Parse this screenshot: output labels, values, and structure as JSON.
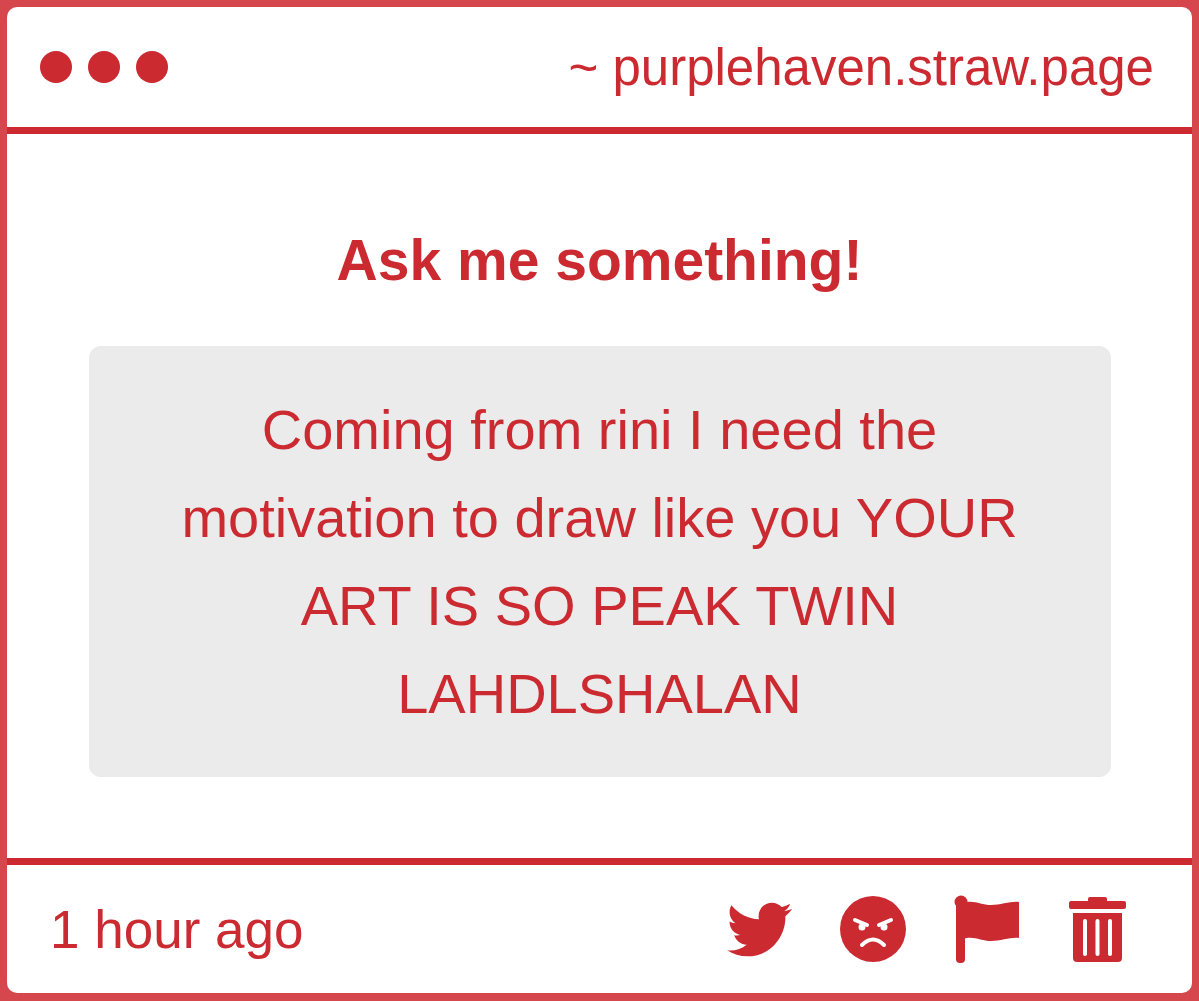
{
  "window": {
    "url": "~ purplehaven.straw.page"
  },
  "prompt": "Ask me something!",
  "message": "Coming from rini I need the motivation to draw like you YOUR ART IS SO PEAK TWIN LAHDLSHALAN",
  "footer": {
    "time": "1 hour ago",
    "actions": [
      {
        "kind": "twitter"
      },
      {
        "kind": "angry"
      },
      {
        "kind": "flag"
      },
      {
        "kind": "delete"
      }
    ]
  }
}
